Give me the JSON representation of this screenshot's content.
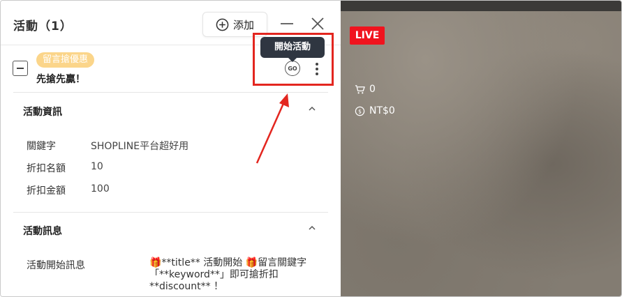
{
  "header": {
    "title": "活動（1）",
    "add_label": "添加"
  },
  "campaign": {
    "tag": "留言搶優惠",
    "name": "先搶先贏！",
    "go_label": "GO",
    "tooltip": "開始活動"
  },
  "info_section": {
    "title": "活動資訊",
    "rows": [
      {
        "label": "關鍵字",
        "value": "SHOPLINE平台超好用"
      },
      {
        "label": "折扣名額",
        "value": "10"
      },
      {
        "label": "折扣金額",
        "value": "100"
      }
    ]
  },
  "message_section": {
    "title": "活動訊息",
    "start_label": "活動開始訊息",
    "start_text": "🎁**title** 活動開始 🎁留言關鍵字「**keyword**」即可搶折扣 **discount** ！"
  },
  "live": {
    "badge": "LIVE",
    "cart_count": "0",
    "revenue": "NT$0"
  },
  "colors": {
    "accent_red": "#e3261f",
    "live_red": "#f0131e",
    "tag_yellow": "#fbd58a",
    "tooltip_bg": "#2f3641"
  }
}
